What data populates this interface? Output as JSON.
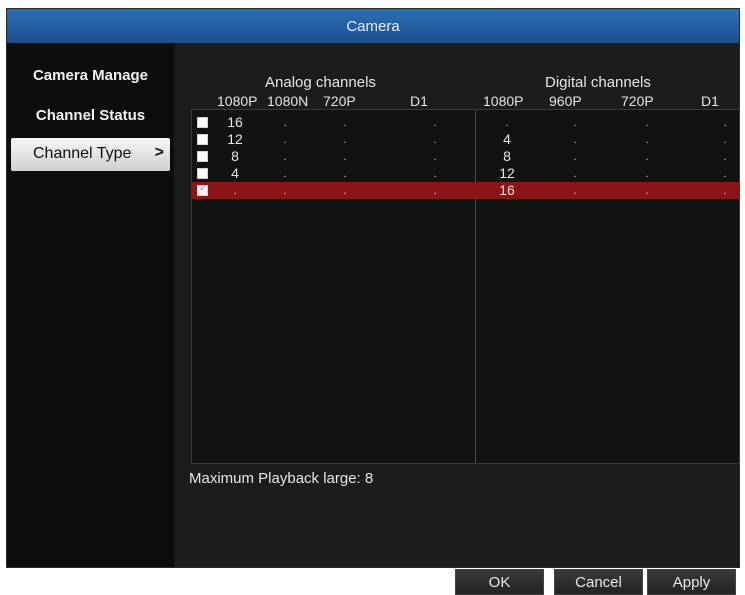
{
  "window": {
    "title": "Camera"
  },
  "sidebar": {
    "items": [
      {
        "label": "Camera Manage"
      },
      {
        "label": "Channel Status"
      },
      {
        "label": "Channel Type",
        "chevron": ">"
      }
    ]
  },
  "grid": {
    "analog_header": "Analog channels",
    "digital_header": "Digital channels",
    "analog_columns": [
      "1080P",
      "1080N",
      "720P",
      "D1"
    ],
    "digital_columns": [
      "1080P",
      "960P",
      "720P",
      "D1"
    ],
    "rows": [
      {
        "checked": false,
        "selected": false,
        "analog": [
          "16",
          ".",
          ".",
          "."
        ],
        "digital": [
          ".",
          ".",
          ".",
          "."
        ]
      },
      {
        "checked": false,
        "selected": false,
        "analog": [
          "12",
          ".",
          ".",
          "."
        ],
        "digital": [
          "4",
          ".",
          ".",
          "."
        ]
      },
      {
        "checked": false,
        "selected": false,
        "analog": [
          "8",
          ".",
          ".",
          "."
        ],
        "digital": [
          "8",
          ".",
          ".",
          "."
        ]
      },
      {
        "checked": false,
        "selected": false,
        "analog": [
          "4",
          ".",
          ".",
          "."
        ],
        "digital": [
          "12",
          ".",
          ".",
          "."
        ]
      },
      {
        "checked": true,
        "selected": true,
        "analog": [
          ".",
          ".",
          ".",
          "."
        ],
        "digital": [
          "16",
          ".",
          ".",
          "."
        ]
      }
    ]
  },
  "footer": {
    "max_playback": "Maximum Playback large: 8"
  },
  "buttons": {
    "ok": "OK",
    "cancel": "Cancel",
    "apply": "Apply"
  },
  "colors": {
    "title_bar": "#2666a6",
    "selection": "#8d1414",
    "background": "#1c1c1c"
  }
}
